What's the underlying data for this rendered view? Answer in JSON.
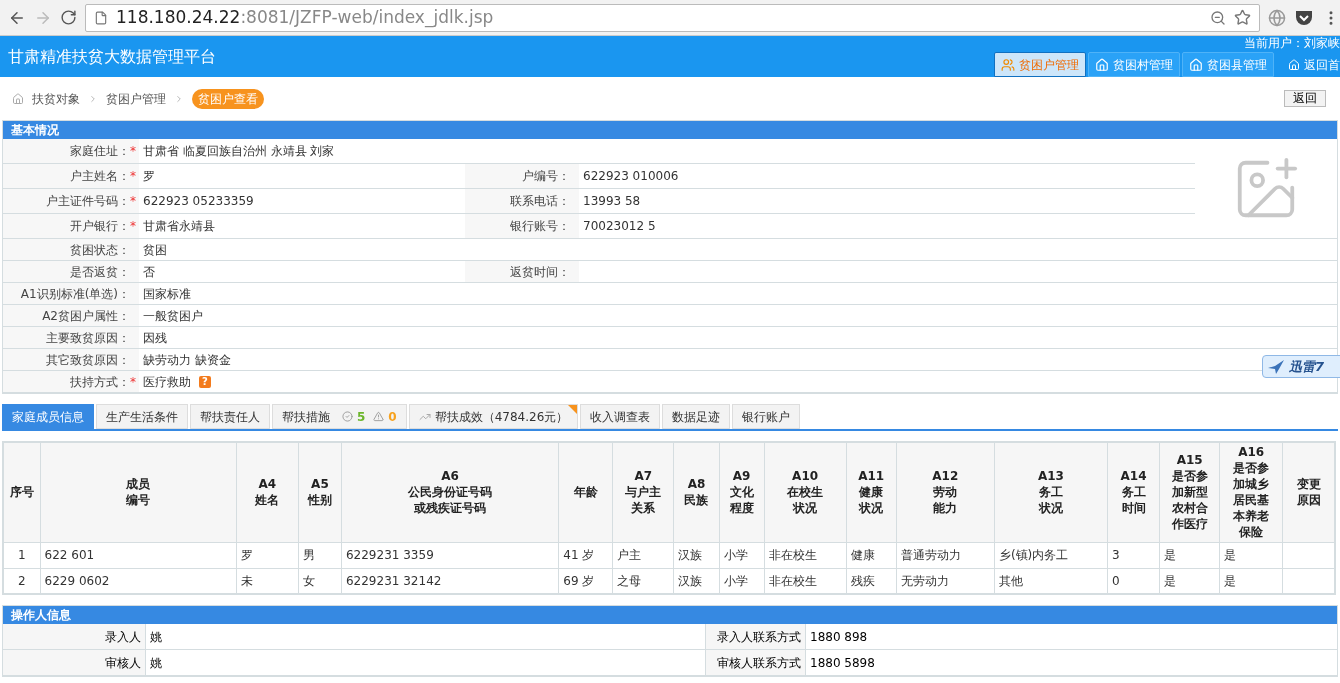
{
  "browser": {
    "url_host": "118.180.24.22",
    "url_path": ":8081/JZFP-web/index_jdlk.jsp"
  },
  "header": {
    "title": "甘肃精准扶贫大数据管理平台",
    "current_user": "当前用户：刘家峡",
    "nav": [
      {
        "label": "贫困户管理",
        "kind": "people",
        "selected": true
      },
      {
        "label": "贫困村管理",
        "kind": "house",
        "selected": false
      },
      {
        "label": "贫困县管理",
        "kind": "house",
        "selected": false
      }
    ],
    "home_link": "返回首"
  },
  "breadcrumb": [
    {
      "label": "扶贫对象",
      "selected": false
    },
    {
      "label": "贫困户管理",
      "selected": false
    },
    {
      "label": "贫困户查看",
      "selected": true
    }
  ],
  "back_button": "返回",
  "basic_info": {
    "title": "基本情况",
    "top_rows": [
      {
        "fields": [
          {
            "label": "家庭住址：",
            "required_mark": "*",
            "value": "甘肃省 临夏回族自治州 永靖县 刘家"
          }
        ]
      },
      {
        "fields": [
          {
            "label": "户主姓名：",
            "required_mark": "*",
            "value": "罗"
          },
          {
            "label": "户编号：",
            "value": "622923 010006"
          }
        ]
      },
      {
        "fields": [
          {
            "label": "户主证件号码：",
            "required_mark": "*",
            "value": "622923 05233359"
          },
          {
            "label": "联系电话：",
            "value": "13993 58"
          }
        ]
      },
      {
        "fields": [
          {
            "label": "开户银行：",
            "required_mark": "*",
            "value": "甘肃省永靖县"
          },
          {
            "label": "银行账号：",
            "value": "70023012 5"
          }
        ]
      }
    ],
    "rows": [
      {
        "fields": [
          {
            "label": "贫困状态：",
            "value": "贫困"
          }
        ]
      },
      {
        "fields": [
          {
            "label": "是否返贫：",
            "value": "否"
          },
          {
            "label": "返贫时间："
          }
        ]
      },
      {
        "fields": [
          {
            "label": "A1识别标准(单选)：",
            "value": "国家标准"
          }
        ]
      },
      {
        "fields": [
          {
            "label": "A2贫困户属性：",
            "value": "一般贫困户"
          }
        ]
      },
      {
        "fields": [
          {
            "label": "主要致贫原因：",
            "value": "因残"
          }
        ]
      },
      {
        "fields": [
          {
            "label": "其它致贫原因：",
            "value": "缺劳动力 缺资金"
          }
        ]
      },
      {
        "fields": [
          {
            "label": "扶持方式：",
            "required_mark": "*",
            "value": "医疗救助",
            "help": "?"
          }
        ]
      }
    ]
  },
  "tabs": [
    {
      "label": "家庭成员信息",
      "selected": true
    },
    {
      "label": "生产生活条件",
      "selected": false
    },
    {
      "label": "帮扶责任人",
      "selected": false
    },
    {
      "label": "帮扶措施",
      "selected": false,
      "badges": [
        {
          "kind": "ok",
          "text": "5"
        },
        {
          "kind": "warn",
          "text": "0"
        }
      ]
    },
    {
      "label": "帮扶成效（4784.26元）",
      "selected": false,
      "kind": "trend",
      "flagged": true
    },
    {
      "label": "收入调查表",
      "selected": false
    },
    {
      "label": "数据足迹",
      "selected": false
    },
    {
      "label": "银行账户",
      "selected": false
    }
  ],
  "members_table": {
    "columns": [
      {
        "lines": [
          "序号"
        ]
      },
      {
        "lines": [
          "成员",
          "编号"
        ]
      },
      {
        "code": "A4",
        "lines": [
          "姓名"
        ]
      },
      {
        "code": "A5",
        "lines": [
          "性别"
        ]
      },
      {
        "code": "A6",
        "lines": [
          "公民身份证号码",
          "或残疾证号码"
        ]
      },
      {
        "lines": [
          "年龄"
        ]
      },
      {
        "code": "A7",
        "lines": [
          "与户主",
          "关系"
        ]
      },
      {
        "code": "A8",
        "lines": [
          "民族"
        ]
      },
      {
        "code": "A9",
        "lines": [
          "文化",
          "程度"
        ]
      },
      {
        "code": "A10",
        "lines": [
          "在校生",
          "状况"
        ]
      },
      {
        "code": "A11",
        "lines": [
          "健康",
          "状况"
        ]
      },
      {
        "code": "A12",
        "lines": [
          "劳动",
          "能力"
        ]
      },
      {
        "code": "A13",
        "lines": [
          "务工",
          "状况"
        ]
      },
      {
        "code": "A14",
        "lines": [
          "务工",
          "时间"
        ]
      },
      {
        "code": "A15",
        "lines": [
          "是否参",
          "加新型",
          "农村合",
          "作医疗"
        ]
      },
      {
        "code": "A16",
        "lines": [
          "是否参",
          "加城乡",
          "居民基",
          "本养老",
          "保险"
        ]
      },
      {
        "lines": [
          "变更",
          "原因"
        ]
      }
    ],
    "rows": [
      [
        "1",
        "622 601",
        "罗",
        "男",
        "6229231 3359",
        "41 岁",
        "户主",
        "汉族",
        "小学",
        "非在校生",
        "健康",
        "普通劳动力",
        "乡(镇)内务工",
        "3",
        "是",
        "是",
        ""
      ],
      [
        "2",
        "6229 0602",
        "未",
        "女",
        "6229231 32142",
        "69 岁",
        "之母",
        "汉族",
        "小学",
        "非在校生",
        "残疾",
        "无劳动力",
        "其他",
        "0",
        "是",
        "是",
        ""
      ]
    ]
  },
  "operator_info": {
    "title": "操作人信息",
    "rows": [
      {
        "label": "录入人",
        "value": "姚",
        "contact_label": "录入人联系方式",
        "contact": "1880 898"
      },
      {
        "label": "审核人",
        "value": "姚",
        "contact_label": "审核人联系方式",
        "contact": "1880 5898"
      }
    ]
  },
  "floating_badge": "迅雷7"
}
